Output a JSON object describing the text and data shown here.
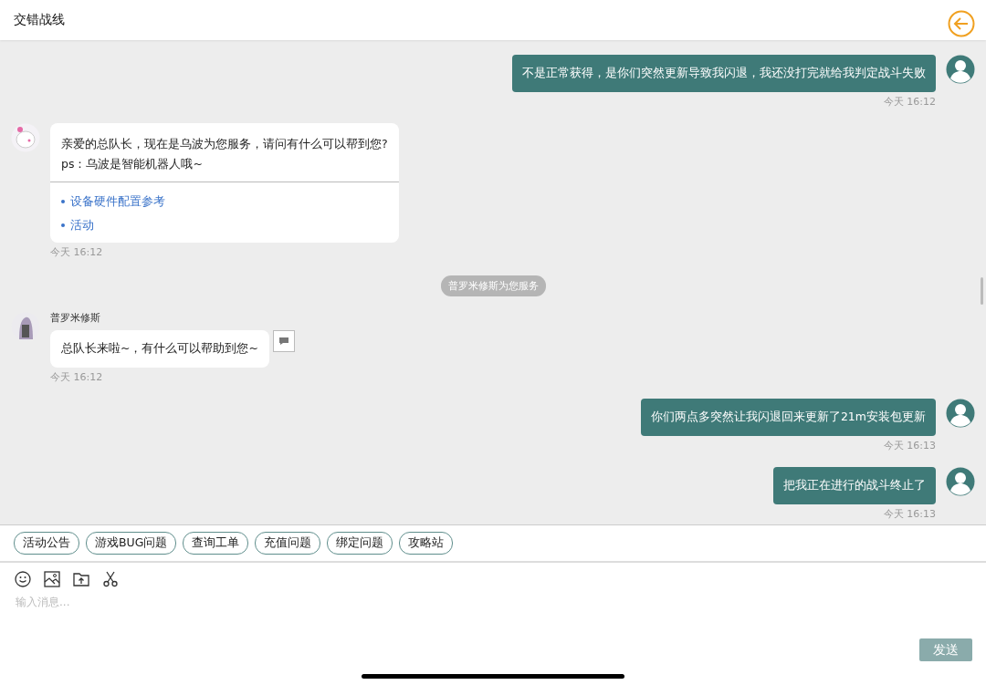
{
  "header": {
    "title": "交错战线"
  },
  "messages": [
    {
      "kind": "user",
      "text": "不是正常获得，是你们突然更新导致我闪退，我还没打完就给我判定战斗失败",
      "time": "今天 16:12"
    },
    {
      "kind": "bot",
      "text": "亲爱的总队长，现在是乌波为您服务，请问有什么可以帮到您?\nps：乌波是智能机器人哦~",
      "links": [
        "设备硬件配置参考",
        "活动"
      ],
      "time": "今天 16:12"
    },
    {
      "kind": "system",
      "text": "普罗米修斯为您服务"
    },
    {
      "kind": "agent",
      "name": "普罗米修斯",
      "text": "总队长来啦~，有什么可以帮助到您~",
      "time": "今天 16:12"
    },
    {
      "kind": "user",
      "text": "你们两点多突然让我闪退回来更新了21m安装包更新",
      "time": "今天 16:13"
    },
    {
      "kind": "user",
      "text": "把我正在进行的战斗终止了",
      "time": "今天 16:13"
    }
  ],
  "quick_replies": [
    "活动公告",
    "游戏BUG问题",
    "查询工单",
    "充值问题",
    "绑定问题",
    "攻略站"
  ],
  "composer": {
    "placeholder": "输入消息...",
    "send": "发送"
  }
}
